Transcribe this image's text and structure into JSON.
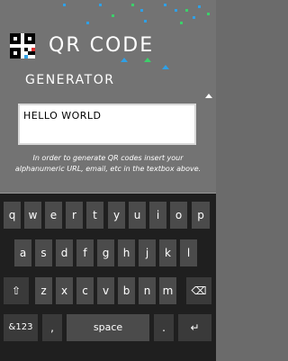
{
  "header": {
    "title_line1": "QR CODE",
    "title_line2": "GENERATOR"
  },
  "input": {
    "value": "HELLO WORLD"
  },
  "hint": {
    "text": "In order to generate QR codes insert your alphanumeric URL, email, etc in the textbox above."
  },
  "keyboard": {
    "row1": [
      "q",
      "w",
      "e",
      "r",
      "t",
      "y",
      "u",
      "i",
      "o",
      "p"
    ],
    "row2": [
      "a",
      "s",
      "d",
      "f",
      "g",
      "h",
      "j",
      "k",
      "l"
    ],
    "row3": [
      "z",
      "x",
      "c",
      "v",
      "b",
      "n",
      "m"
    ],
    "shift_glyph": "⇧",
    "backspace_glyph": "⌫",
    "symbols_label": "&123",
    "comma_label": ",",
    "space_label": "space",
    "period_label": ".",
    "enter_glyph": "↵"
  },
  "colors": {
    "background": "#737373",
    "keyboard": "#1f1f1f",
    "key": "#4b4b4b",
    "accent_blue": "#2fa0e6",
    "accent_green": "#3ccf6a"
  }
}
